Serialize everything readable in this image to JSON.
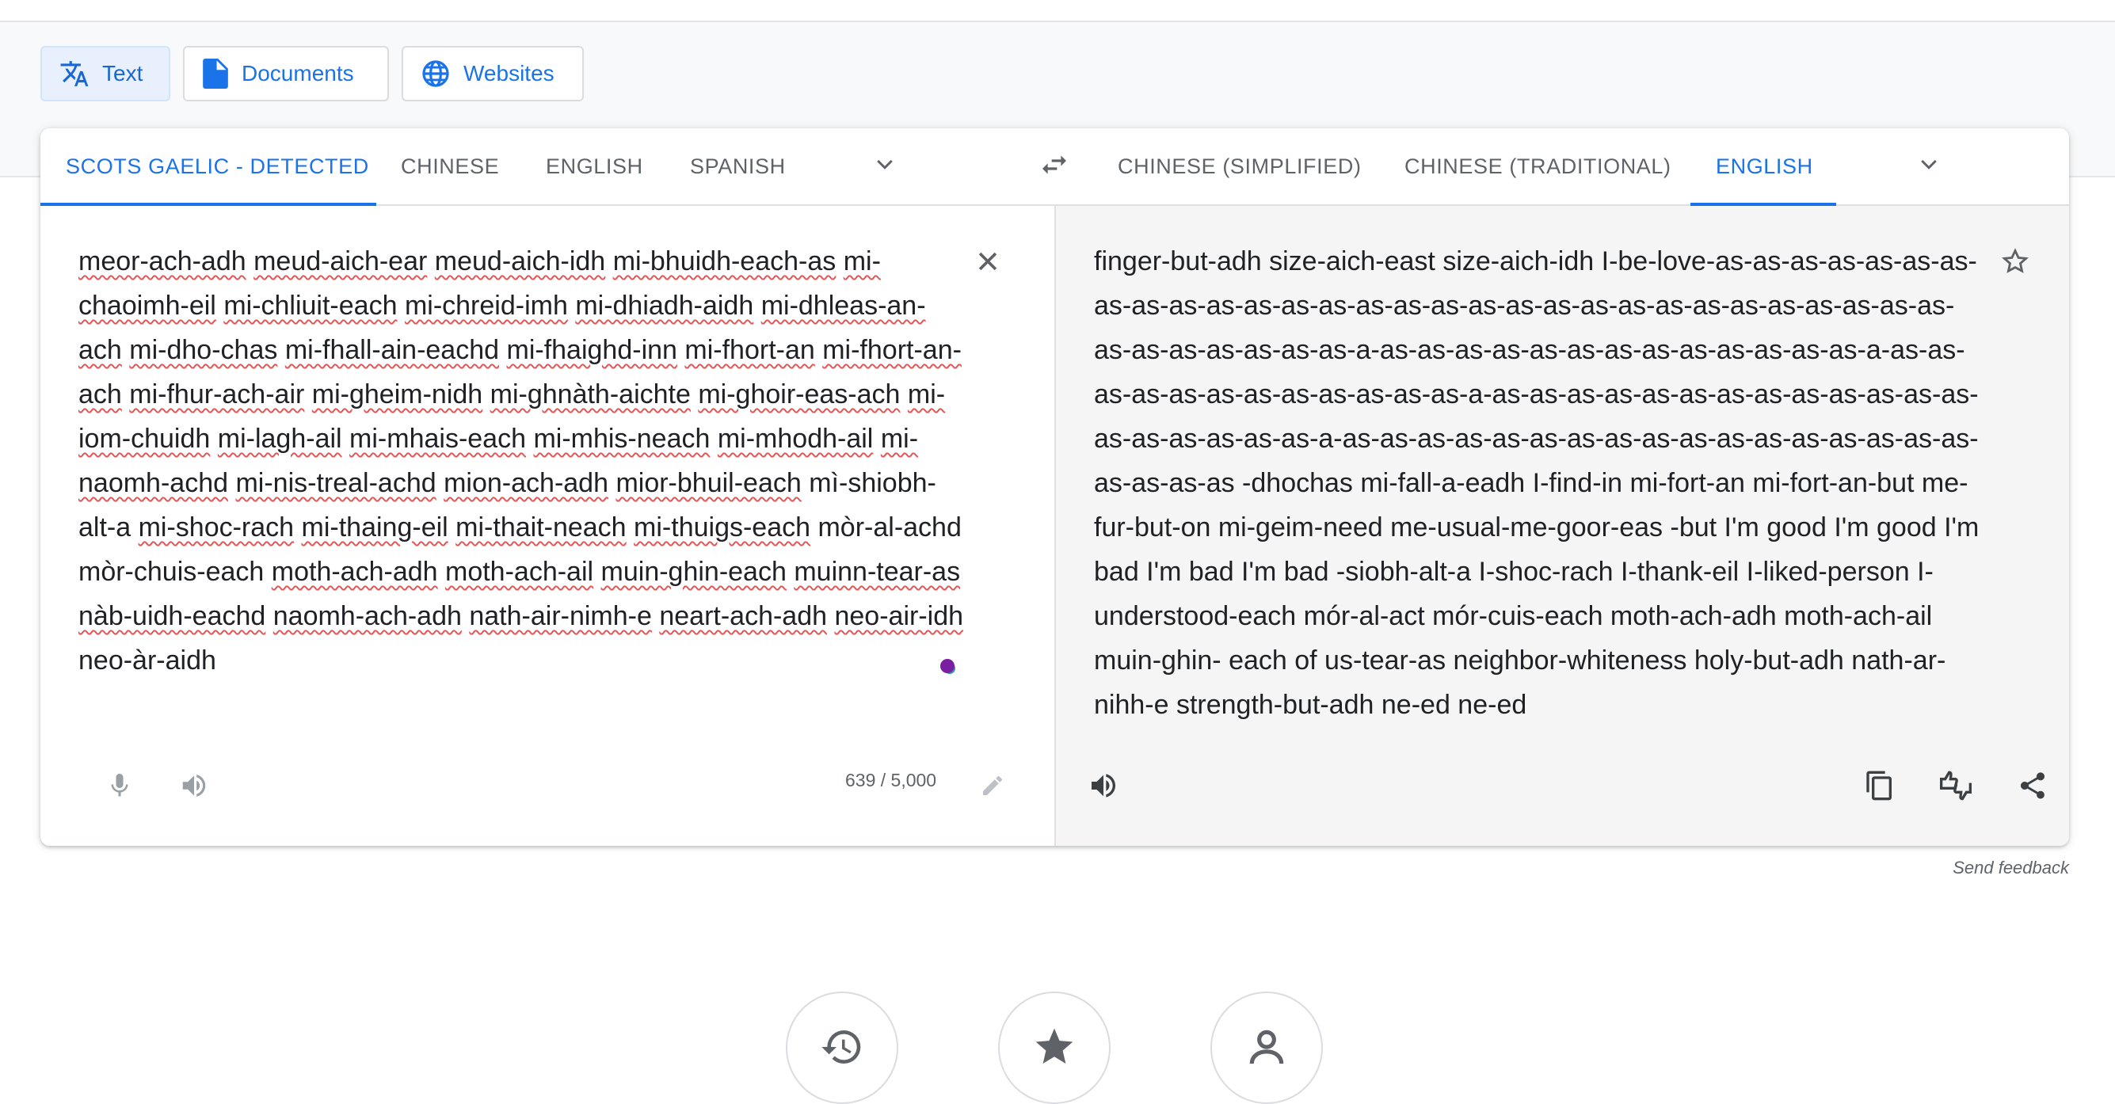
{
  "modes": [
    {
      "label": "Text",
      "icon": "translate-icon",
      "active": true
    },
    {
      "label": "Documents",
      "icon": "document-icon",
      "active": false
    },
    {
      "label": "Websites",
      "icon": "globe-icon",
      "active": false
    }
  ],
  "source_langs": [
    "SCOTS GAELIC - DETECTED",
    "CHINESE",
    "ENGLISH",
    "SPANISH"
  ],
  "target_langs": [
    "CHINESE (SIMPLIFIED)",
    "CHINESE (TRADITIONAL)",
    "ENGLISH"
  ],
  "source": {
    "words": [
      {
        "t": "meor-ach-adh",
        "e": true
      },
      {
        "t": "meud-aich-ear",
        "e": true
      },
      {
        "t": "meud-aich-idh",
        "e": true
      },
      {
        "t": "mi-bhuidh-each-as",
        "e": true
      },
      {
        "t": "mi-chaoimh-eil",
        "e": true
      },
      {
        "t": "mi-chliuit-each",
        "e": true
      },
      {
        "t": "mi-chreid-imh",
        "e": true
      },
      {
        "t": "mi-dhiadh-aidh",
        "e": true
      },
      {
        "t": "mi-dhleas-an-ach",
        "e": true
      },
      {
        "t": "mi-dho-chas",
        "e": true
      },
      {
        "t": "mi-fhall-ain-eachd",
        "e": true
      },
      {
        "t": "mi-fhaighd-inn",
        "e": true
      },
      {
        "t": "mi-fhort-an",
        "e": true
      },
      {
        "t": "mi-fhort-an-ach",
        "e": true
      },
      {
        "t": "mi-fhur-ach-air",
        "e": true
      },
      {
        "t": "mi-gheim-nidh",
        "e": true
      },
      {
        "t": "mi-ghnàth-aichte",
        "e": true
      },
      {
        "t": "mi-ghoir-eas-ach",
        "e": true
      },
      {
        "t": "mi-iom-chuidh",
        "e": true
      },
      {
        "t": "mi-lagh-ail",
        "e": true
      },
      {
        "t": "mi-mhais-each",
        "e": true
      },
      {
        "t": "mi-mhis-neach",
        "e": true
      },
      {
        "t": "mi-mhodh-ail",
        "e": true
      },
      {
        "t": "mi-naomh-achd",
        "e": true
      },
      {
        "t": "mi-nis-treal-achd",
        "e": true
      },
      {
        "t": "mion-ach-adh",
        "e": true
      },
      {
        "t": "mior-bhuil-each",
        "e": true
      },
      {
        "t": "mì-shiobh-alt-a",
        "e": false
      },
      {
        "t": "mi-shoc-rach",
        "e": true
      },
      {
        "t": "mi-thaing-eil",
        "e": true
      },
      {
        "t": "mi-thait-neach",
        "e": true
      },
      {
        "t": "mi-thuigs-each",
        "e": true
      },
      {
        "t": "mòr-al-achd",
        "e": false
      },
      {
        "t": "mòr-chuis-each",
        "e": false
      },
      {
        "t": "moth-ach-adh",
        "e": true
      },
      {
        "t": "moth-ach-ail",
        "e": true
      },
      {
        "t": "muin-ghin-each",
        "e": true
      },
      {
        "t": "muinn-tear-as",
        "e": true
      },
      {
        "t": "nàb-uidh-eachd",
        "e": true
      },
      {
        "t": "naomh-ach-adh",
        "e": true
      },
      {
        "t": "nath-air-nimh-e",
        "e": true
      },
      {
        "t": "neart-ach-adh",
        "e": true
      },
      {
        "t": "neo-air-idh",
        "e": true
      },
      {
        "t": "neo-àr-aidh",
        "e": false
      }
    ],
    "char_count": "639 / 5,000"
  },
  "translation": {
    "text": "finger-but-adh size-aich-east size-aich-idh I-be-love-as-as-as-as-as-as-as-as-as-as-as-as-as-as-as-as-as-as-as-as-as-as-as-as-as-as-as-as-as-as-as-as-as-as-as-as-as-a-as-as-as-as-as-as-as-as-as-as-as-as-as-a-as-as-as-as-as-as-as-as-as-as-as-as-a-as-as-as-as-as-as-as-as-as-as-as-as-as-as-as-as-as-as-as-a-as-as-as-as-as-as-as-as-as-as-as-as-as-as-as-as-as-as-as-as-as -dhochas mi-fall-a-eadh I-find-in mi-fort-an mi-fort-an-but me-fur-but-on mi-geim-need me-usual-me-goor-eas -but I'm good I'm good I'm bad I'm bad I'm bad -siobh-alt-a I-shoc-rach I-thank-eil I-liked-person I-understood-each mór-al-act mór-cuis-each moth-ach-adh moth-ach-ail muin-ghin- each of us-tear-as neighbor-whiteness holy-but-adh nath-ar-nihh-e strength-but-adh ne-ed ne-ed"
  },
  "send_feedback": "Send feedback",
  "bottom_buttons": [
    "history-icon",
    "saved-star-icon",
    "contribute-icon"
  ]
}
